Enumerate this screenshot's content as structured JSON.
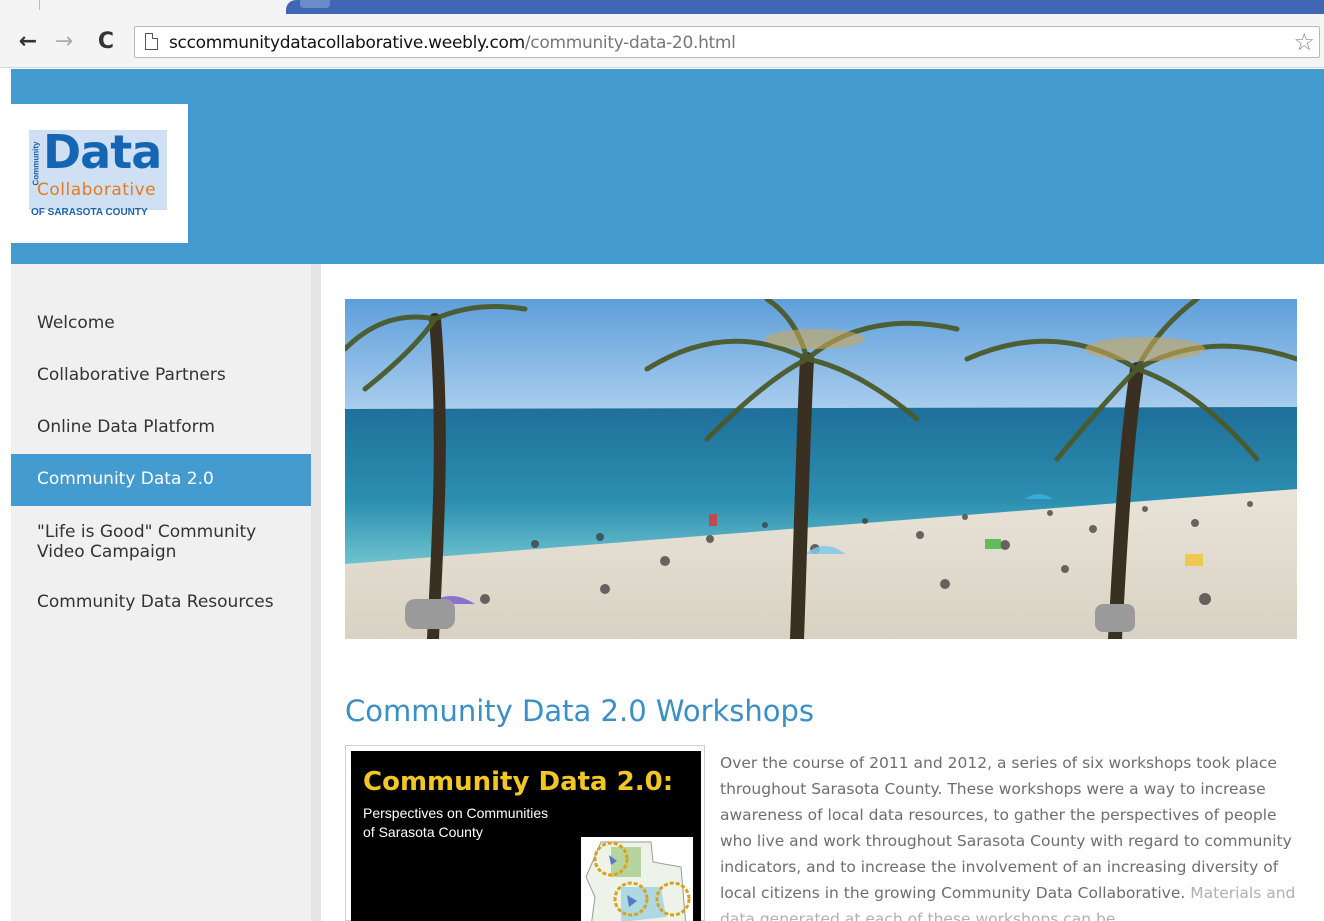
{
  "browser": {
    "url_host": "sccommunitydatacollaborative.weebly.com",
    "url_path": "/community-data-20.html",
    "back_glyph": "←",
    "forward_glyph": "→",
    "reload_glyph": "C",
    "star_glyph": "☆"
  },
  "logo": {
    "vertical": "Community",
    "word1": "Data",
    "word2": "Collaborative",
    "county": "OF SARASOTA COUNTY"
  },
  "sidebar": {
    "items": [
      {
        "label": "Welcome",
        "active": false
      },
      {
        "label": "Collaborative Partners",
        "active": false
      },
      {
        "label": "Online Data Platform",
        "active": false
      },
      {
        "label": "Community Data 2.0",
        "active": true
      },
      {
        "label": "\"Life is Good\" Community Video Campaign",
        "active": false
      },
      {
        "label": "Community Data Resources",
        "active": false
      }
    ]
  },
  "main": {
    "heading": "Community Data 2.0 Workshops",
    "thumb_title": "Community Data 2.0:",
    "thumb_sub1": "Perspectives on Communities",
    "thumb_sub2": "of Sarasota County",
    "body": "Over the course of 2011 and 2012, a series of six workshops took place throughout Sarasota County.  These workshops were a way to increase awareness of local data resources, to gather the perspectives of people who live and work throughout Sarasota County with regard to community indicators, and to increase the involvement of an increasing diversity of local citizens in the growing Community Data Collaborative.",
    "body_cut": "Materials and data generated at each of these workshops can be"
  },
  "colors": {
    "brand_blue": "#449bd0",
    "heading_blue": "#3a8fc7",
    "logo_orange": "#e67a1e",
    "thumb_gold": "#f2c624"
  }
}
